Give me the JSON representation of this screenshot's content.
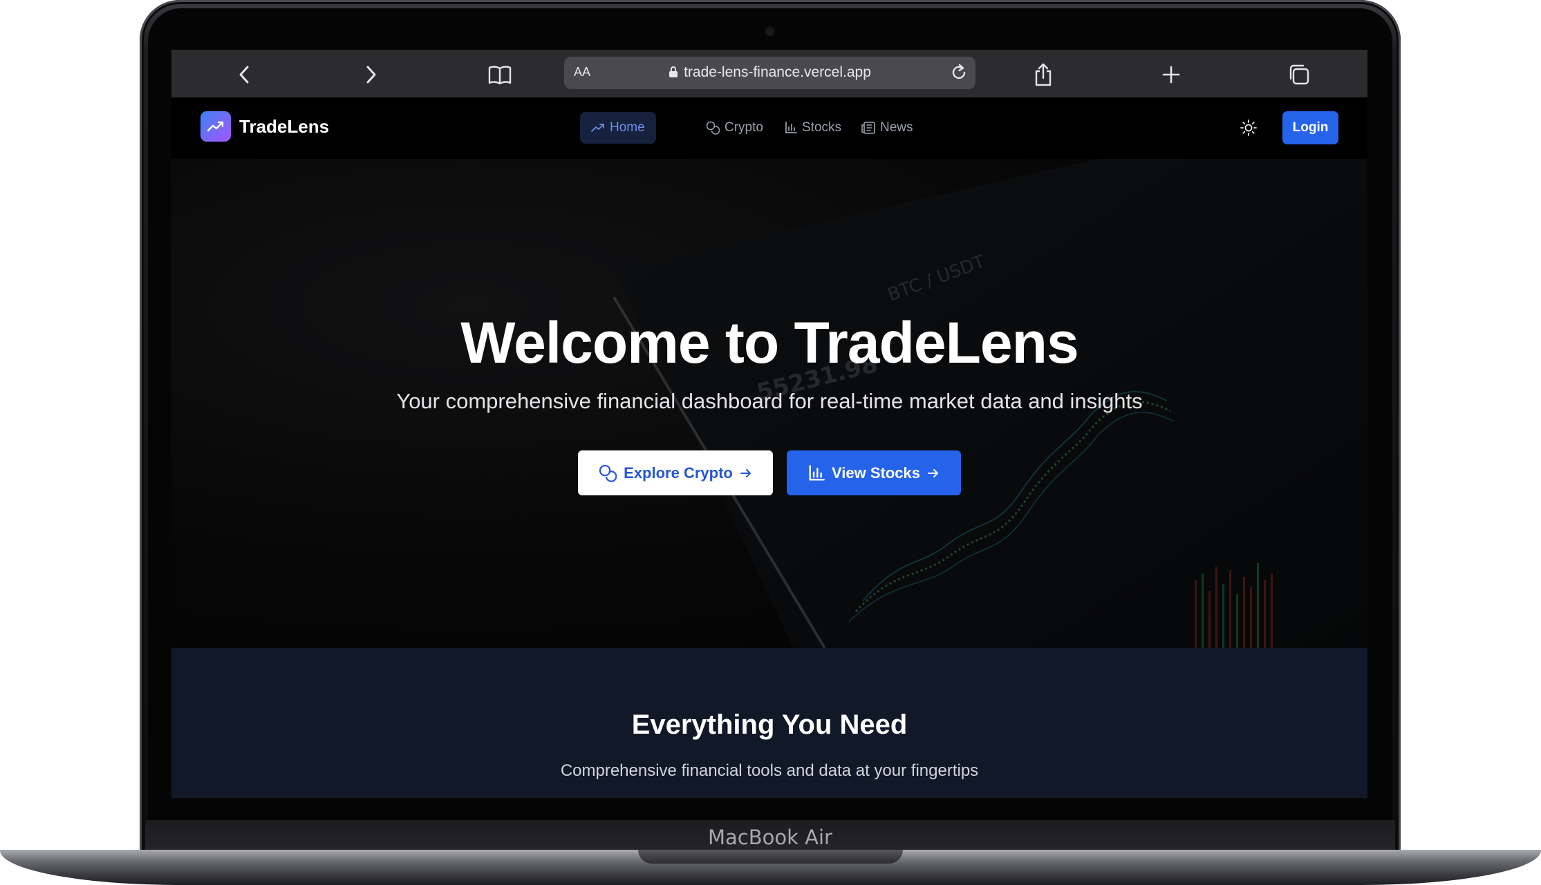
{
  "device": {
    "label": "MacBook Air"
  },
  "browser": {
    "text_size_label": "AA",
    "url": "trade-lens-finance.vercel.app"
  },
  "app": {
    "brand": "TradeLens",
    "nav": [
      {
        "label": "Home",
        "icon": "trending-up-icon",
        "active": true
      },
      {
        "label": "Crypto",
        "icon": "coins-icon",
        "active": false
      },
      {
        "label": "Stocks",
        "icon": "bar-chart-icon",
        "active": false
      },
      {
        "label": "News",
        "icon": "newspaper-icon",
        "active": false
      }
    ],
    "login_label": "Login",
    "theme_icon": "sun-icon"
  },
  "hero": {
    "title": "Welcome to TradeLens",
    "subtitle": "Your comprehensive financial dashboard for real-time market data and insights",
    "primary_button": "Explore Crypto",
    "secondary_button": "View Stocks",
    "background_text": [
      "BTC / USDT",
      "55231.98"
    ]
  },
  "features": {
    "title": "Everything You Need",
    "subtitle": "Comprehensive financial tools and data at your fingertips"
  },
  "colors": {
    "accent": "#2563eb",
    "active_nav_bg": "#16213e",
    "features_bg": "#111827"
  }
}
